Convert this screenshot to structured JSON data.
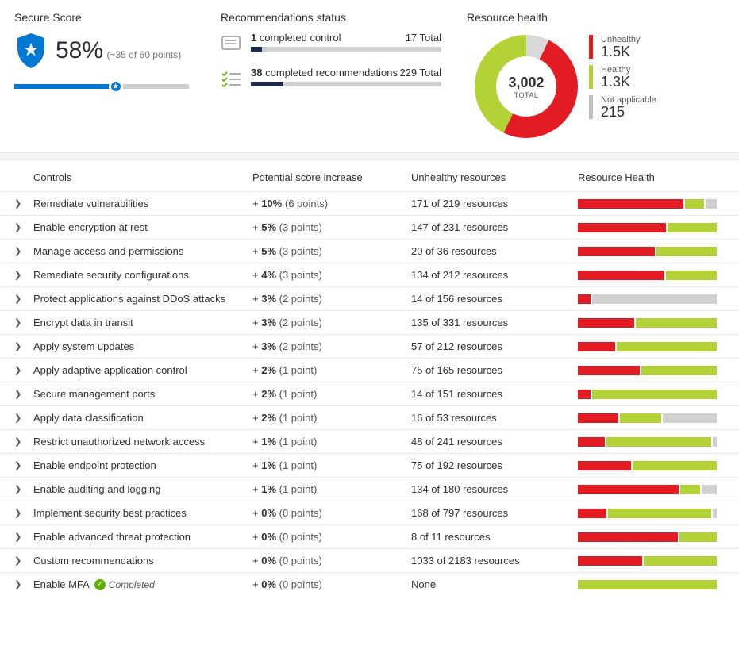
{
  "secureScore": {
    "title": "Secure Score",
    "percentText": "58%",
    "percent": 58,
    "sub": "(~35 of 60 points)"
  },
  "recStatus": {
    "title": "Recommendations status",
    "controls": {
      "count": "1",
      "label": "completed control",
      "totalLabel": "17 Total",
      "fillPct": 6
    },
    "recs": {
      "count": "38",
      "label": "completed recommendations",
      "totalLabel": "229 Total",
      "fillPct": 17
    }
  },
  "resourceHealth": {
    "title": "Resource health",
    "total": "3,002",
    "totalLabel": "TOTAL",
    "legend": {
      "unhealthy": {
        "cap": "Unhealthy",
        "val": "1.5K"
      },
      "healthy": {
        "cap": "Healthy",
        "val": "1.3K"
      },
      "na": {
        "cap": "Not applicable",
        "val": "215"
      }
    }
  },
  "chart_data": {
    "type": "pie",
    "title": "Resource health",
    "series": [
      {
        "name": "Unhealthy",
        "value": 1500,
        "display": "1.5K",
        "color": "#e31b23"
      },
      {
        "name": "Healthy",
        "value": 1300,
        "display": "1.3K",
        "color": "#b2d235"
      },
      {
        "name": "Not applicable",
        "value": 215,
        "display": "215",
        "color": "#d0d0d0"
      }
    ],
    "total": 3002
  },
  "table": {
    "headers": {
      "controls": "Controls",
      "score": "Potential score increase",
      "unhealthy": "Unhealthy resources",
      "health": "Resource Health"
    },
    "rows": [
      {
        "name": "Remediate vulnerabilities",
        "pct": "+ 10%",
        "pts": "(6 points)",
        "unh": "171 of 219 resources",
        "bar": {
          "r": 78,
          "g": 14,
          "x": 8
        }
      },
      {
        "name": "Enable encryption at rest",
        "pct": "+ 5%",
        "pts": "(3 points)",
        "unh": "147 of 231 resources",
        "bar": {
          "r": 64,
          "g": 36,
          "x": 0
        }
      },
      {
        "name": "Manage access and permissions",
        "pct": "+ 5%",
        "pts": "(3 points)",
        "unh": "20 of 36 resources",
        "bar": {
          "r": 56,
          "g": 44,
          "x": 0
        }
      },
      {
        "name": "Remediate security configurations",
        "pct": "+ 4%",
        "pts": "(3 points)",
        "unh": "134 of 212 resources",
        "bar": {
          "r": 63,
          "g": 37,
          "x": 0
        }
      },
      {
        "name": "Protect applications against DDoS attacks",
        "pct": "+ 3%",
        "pts": "(2 points)",
        "unh": "14 of 156 resources",
        "bar": {
          "r": 9,
          "g": 0,
          "x": 91
        }
      },
      {
        "name": "Encrypt data in transit",
        "pct": "+ 3%",
        "pts": "(2 points)",
        "unh": "135 of 331 resources",
        "bar": {
          "r": 41,
          "g": 59,
          "x": 0
        }
      },
      {
        "name": "Apply system updates",
        "pct": "+ 3%",
        "pts": "(2 points)",
        "unh": "57 of 212 resources",
        "bar": {
          "r": 27,
          "g": 73,
          "x": 0
        }
      },
      {
        "name": "Apply adaptive application control",
        "pct": "+ 2%",
        "pts": "(1 point)",
        "unh": "75 of 165 resources",
        "bar": {
          "r": 45,
          "g": 55,
          "x": 0
        }
      },
      {
        "name": "Secure management ports",
        "pct": "+ 2%",
        "pts": "(1 point)",
        "unh": "14 of 151 resources",
        "bar": {
          "r": 9,
          "g": 91,
          "x": 0
        }
      },
      {
        "name": "Apply data classification",
        "pct": "+ 2%",
        "pts": "(1 point)",
        "unh": "16 of 53 resources",
        "bar": {
          "r": 30,
          "g": 30,
          "x": 40
        }
      },
      {
        "name": "Restrict unauthorized network access",
        "pct": "+ 1%",
        "pts": "(1 point)",
        "unh": "48 of 241 resources",
        "bar": {
          "r": 20,
          "g": 77,
          "x": 3
        }
      },
      {
        "name": "Enable endpoint protection",
        "pct": "+ 1%",
        "pts": "(1 point)",
        "unh": "75 of 192 resources",
        "bar": {
          "r": 39,
          "g": 61,
          "x": 0
        }
      },
      {
        "name": "Enable auditing and logging",
        "pct": "+ 1%",
        "pts": "(1 point)",
        "unh": "134 of 180 resources",
        "bar": {
          "r": 74,
          "g": 15,
          "x": 11
        }
      },
      {
        "name": "Implement security best practices",
        "pct": "+ 0%",
        "pts": "(0 points)",
        "unh": "168 of 797 resources",
        "bar": {
          "r": 21,
          "g": 76,
          "x": 3
        }
      },
      {
        "name": "Enable advanced threat protection",
        "pct": "+ 0%",
        "pts": "(0 points)",
        "unh": "8 of 11 resources",
        "bar": {
          "r": 73,
          "g": 27,
          "x": 0
        }
      },
      {
        "name": "Custom recommendations",
        "pct": "+ 0%",
        "pts": "(0 points)",
        "unh": "1033 of 2183 resources",
        "bar": {
          "r": 47,
          "g": 53,
          "x": 0
        }
      },
      {
        "name": "Enable MFA",
        "pct": "+ 0%",
        "pts": "(0 points)",
        "unh": "None",
        "bar": {
          "r": 0,
          "g": 100,
          "x": 0
        },
        "completed": true,
        "completedLabel": "Completed"
      }
    ]
  }
}
